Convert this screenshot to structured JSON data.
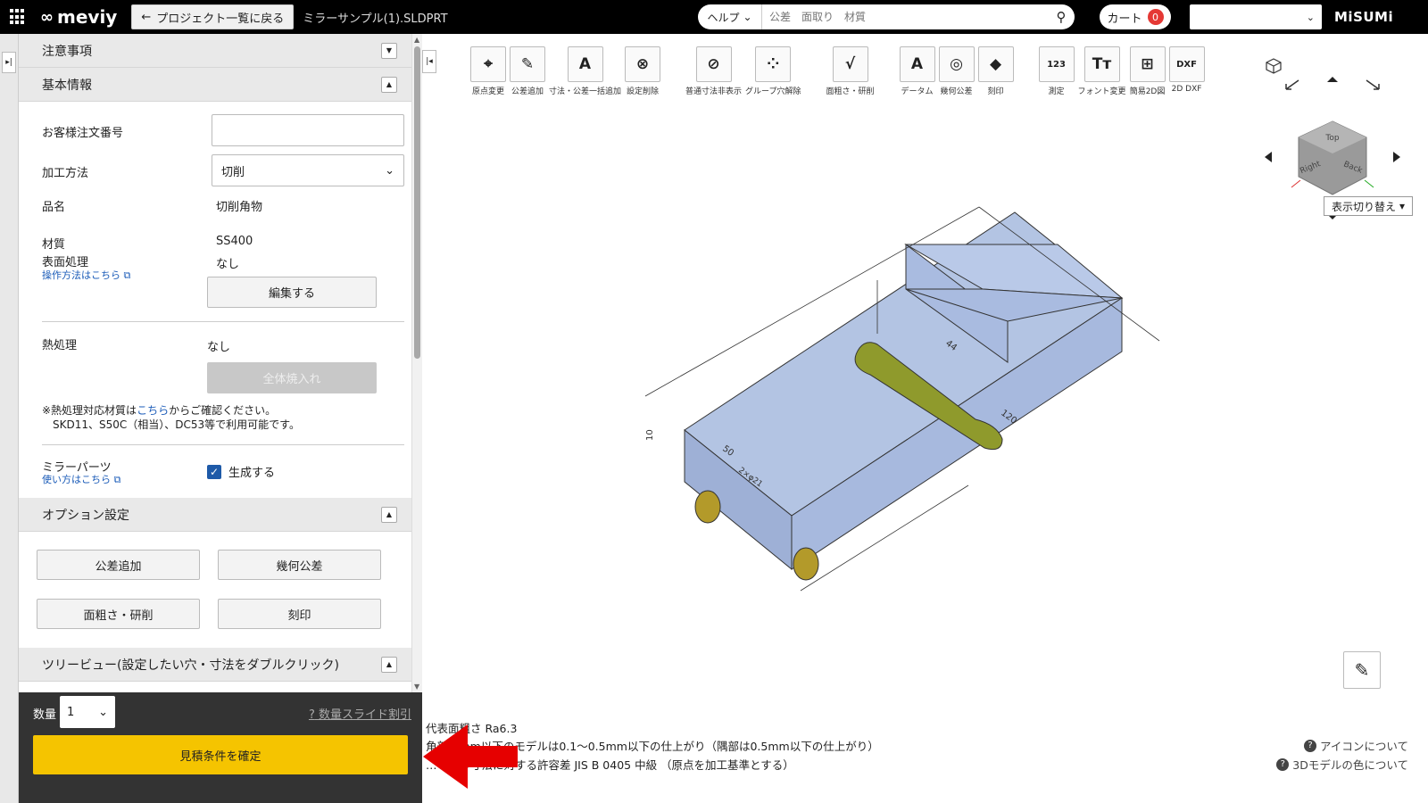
{
  "header": {
    "logo": "meviy",
    "back_label": "プロジェクト一覧に戻る",
    "filename": "ミラーサンプル(1).SLDPRT",
    "search_category": "ヘルプ",
    "search_placeholder": "公差　面取り　材質",
    "cart_label": "カート",
    "cart_count": "0",
    "brand": "MiSUMi"
  },
  "panel": {
    "notice_title": "注意事項",
    "basic_title": "基本情報",
    "order_number_label": "お客様注文番号",
    "order_number_value": "",
    "process_label": "加工方法",
    "process_value": "切削",
    "product_label": "品名",
    "product_value": "切削角物",
    "material_label": "材質",
    "material_value": "SS400",
    "surface_label": "表面処理",
    "surface_value": "なし",
    "howto_link": "操作方法はこちら",
    "edit_button": "編集する",
    "heat_label": "熱処理",
    "heat_value": "なし",
    "quench_button": "全体焼入れ",
    "heat_note_1a": "※熱処理対応材質は",
    "heat_note_link": "こちら",
    "heat_note_1b": "からご確認ください。",
    "heat_note_2": "SKD11、S50C（相当）、DC53等で利用可能です。",
    "mirror_label": "ミラーパーツ",
    "mirror_link": "使い方はこちら",
    "mirror_checkbox_label": "生成する",
    "option_title": "オプション設定",
    "option_buttons": [
      "公差追加",
      "幾何公差",
      "面粗さ・研削",
      "刻印"
    ],
    "tree_title": "ツリービュー(設定したい穴・寸法をダブルクリック)"
  },
  "footer": {
    "qty_label": "数量",
    "qty_value": "1",
    "discount_link": "数量スライド割引",
    "confirm_button": "見積条件を確定"
  },
  "toolbar": {
    "tools": [
      {
        "label": "原点変更",
        "icon": "origin-icon",
        "glyph": "⌖"
      },
      {
        "label": "公差追加",
        "icon": "tolerance-icon",
        "glyph": "✎"
      },
      {
        "label": "寸法・公差一括追加",
        "icon": "bulk-dimension-icon",
        "glyph": "A"
      },
      {
        "label": "設定削除",
        "icon": "delete-setting-icon",
        "glyph": "⊗"
      },
      {
        "label": "普通寸法非表示",
        "icon": "hide-dimension-icon",
        "glyph": "⊘"
      },
      {
        "label": "グループ穴解除",
        "icon": "group-hole-icon",
        "glyph": "⁘"
      },
      {
        "label": "面粗さ・研削",
        "icon": "roughness-icon",
        "glyph": "√"
      },
      {
        "label": "データム",
        "icon": "datum-icon",
        "glyph": "A"
      },
      {
        "label": "幾何公差",
        "icon": "geometric-tolerance-icon",
        "glyph": "◎"
      },
      {
        "label": "刻印",
        "icon": "engrave-icon",
        "glyph": "◆"
      },
      {
        "label": "測定",
        "icon": "measure-icon",
        "glyph": "123"
      },
      {
        "label": "フォント変更",
        "icon": "font-icon",
        "glyph": "Tт"
      },
      {
        "label": "簡易2D図",
        "icon": "2d-view-icon",
        "glyph": "⊞"
      },
      {
        "label": "2D DXF",
        "icon": "dxf-icon",
        "glyph": "DXF"
      }
    ]
  },
  "viewer": {
    "view_mode": "表示切り替え",
    "cube_top": "Top",
    "cube_right": "Right",
    "cube_back": "Back",
    "dims": [
      "44",
      "120",
      "10",
      "50",
      "2×φ21"
    ],
    "info_lines": [
      "代表面粗さ Ra6.3",
      "角部…mm以下のモデルは0.1～0.5mm以下の仕上がり（隅部は0.5mm以下の仕上がり）",
      "…モデル寸法に対する許容差 JIS B 0405 中級 （原点を加工基準とする）"
    ],
    "help_icons": "アイコンについて",
    "help_colors": "3Dモデルの色について"
  }
}
